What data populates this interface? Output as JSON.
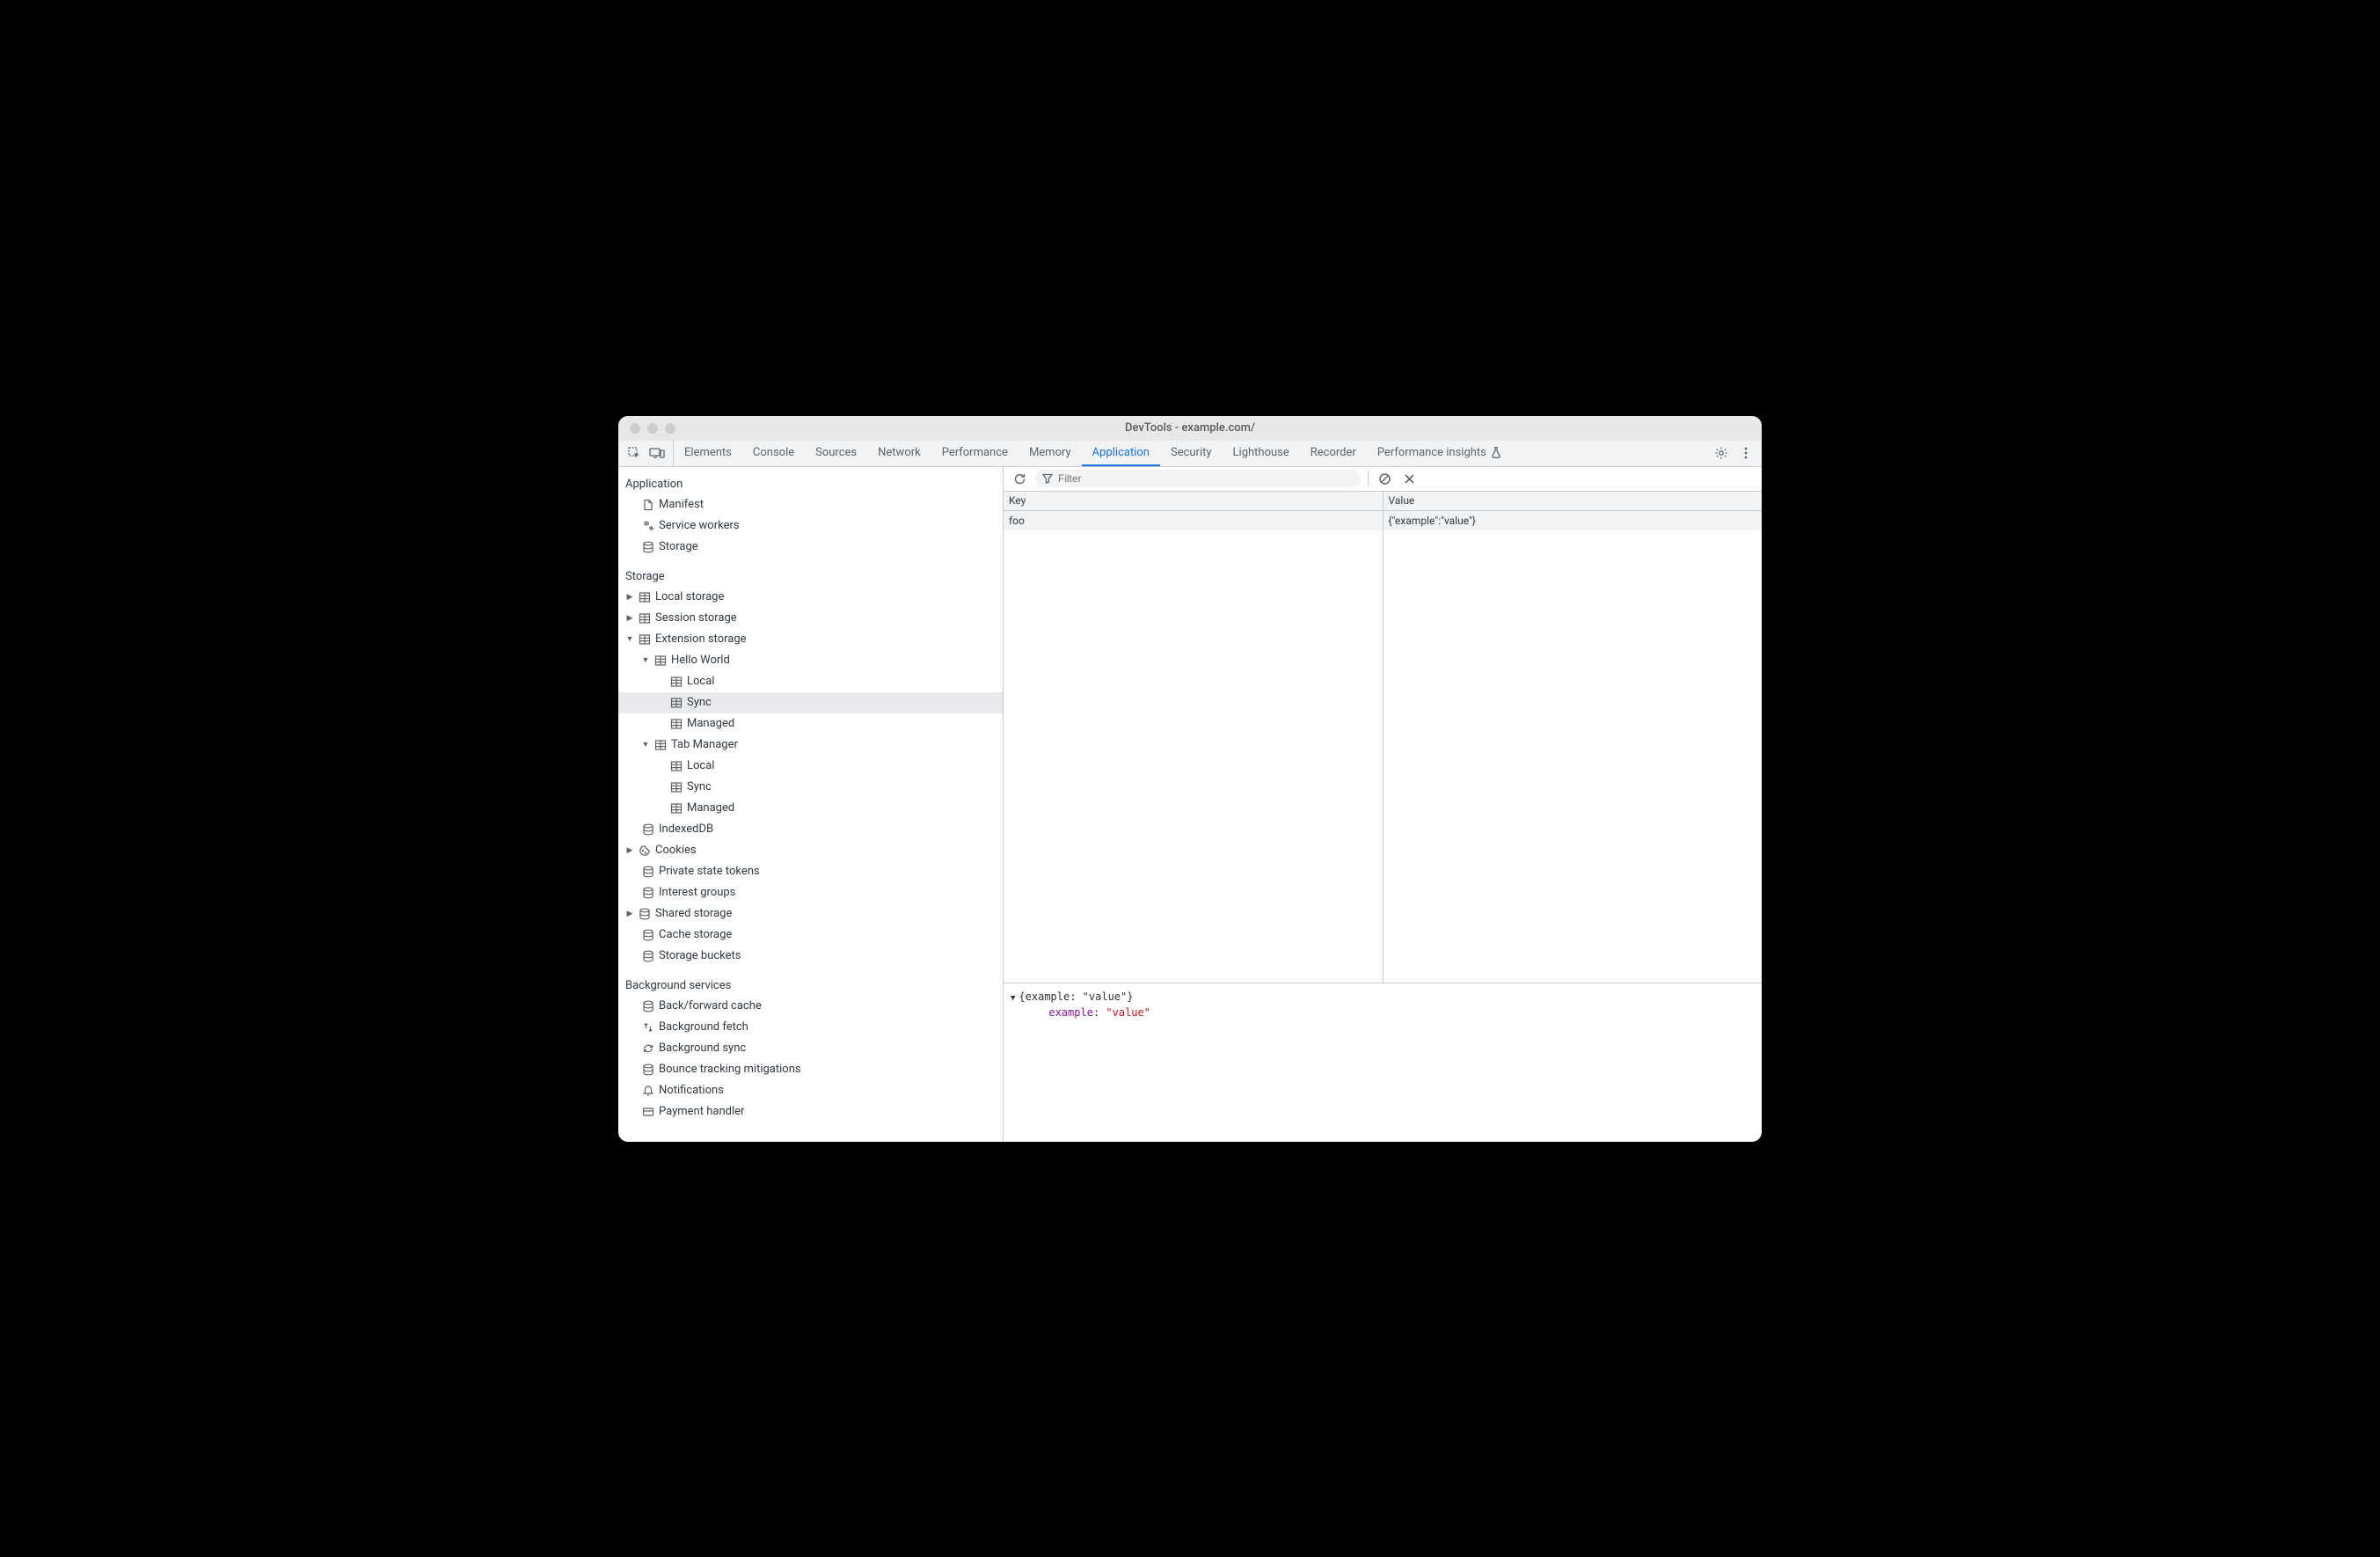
{
  "window": {
    "title": "DevTools - example.com/"
  },
  "tabs": {
    "items": [
      "Elements",
      "Console",
      "Sources",
      "Network",
      "Performance",
      "Memory",
      "Application",
      "Security",
      "Lighthouse",
      "Recorder"
    ],
    "active": "Application",
    "insights": "Performance insights"
  },
  "toolbar": {
    "filter_placeholder": "Filter"
  },
  "sidebar": {
    "section_application": {
      "header": "Application",
      "items": [
        {
          "label": "Manifest",
          "icon": "file"
        },
        {
          "label": "Service workers",
          "icon": "gears"
        },
        {
          "label": "Storage",
          "icon": "db"
        }
      ]
    },
    "section_storage": {
      "header": "Storage",
      "local_storage": "Local storage",
      "session_storage": "Session storage",
      "extension_storage": "Extension storage",
      "hello_world": "Hello World",
      "tab_manager": "Tab Manager",
      "local": "Local",
      "sync": "Sync",
      "managed": "Managed",
      "indexeddb": "IndexedDB",
      "cookies": "Cookies",
      "private_state_tokens": "Private state tokens",
      "interest_groups": "Interest groups",
      "shared_storage": "Shared storage",
      "cache_storage": "Cache storage",
      "storage_buckets": "Storage buckets"
    },
    "section_background": {
      "header": "Background services",
      "back_forward_cache": "Back/forward cache",
      "background_fetch": "Background fetch",
      "background_sync": "Background sync",
      "bounce_tracking": "Bounce tracking mitigations",
      "notifications": "Notifications",
      "payment_handler": "Payment handler"
    }
  },
  "table": {
    "col_key": "Key",
    "col_value": "Value",
    "rows": [
      {
        "key": "foo",
        "value": "{\"example\":\"value\"}"
      }
    ]
  },
  "detail": {
    "summary": "{example: \"value\"}",
    "prop_key": "example",
    "prop_val": "\"value\""
  }
}
